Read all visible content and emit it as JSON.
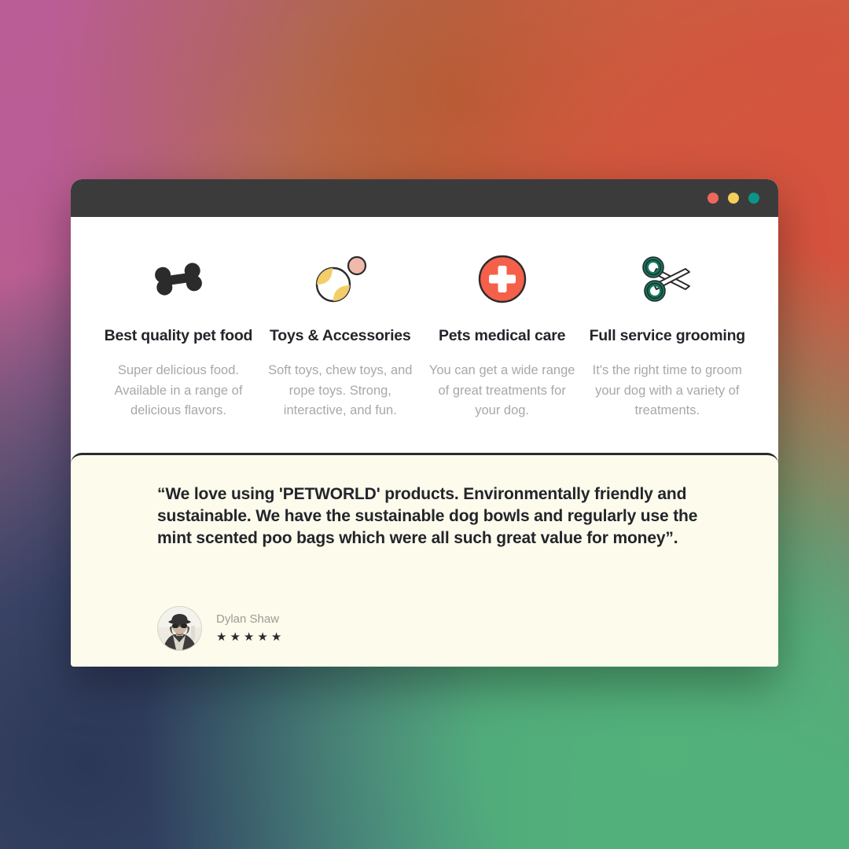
{
  "window": {
    "traffic_lights": [
      {
        "name": "close-button",
        "color": "#f0675c"
      },
      {
        "name": "minimize-button",
        "color": "#f5cd5a"
      },
      {
        "name": "maximize-button",
        "color": "#0d9488"
      }
    ]
  },
  "features": [
    {
      "icon": "bone-icon",
      "title": "Best quality pet food",
      "description": "Super delicious food. Available in a range of delicious flavors."
    },
    {
      "icon": "tennis-balls-icon",
      "title": "Toys & Accessories",
      "description": "Soft toys, chew toys, and rope toys. Strong, interactive, and fun."
    },
    {
      "icon": "medical-cross-icon",
      "title": "Pets medical care",
      "description": "You can get a wide range of great treatments for your dog."
    },
    {
      "icon": "scissors-icon",
      "title": "Full service grooming",
      "description": "It's the right time to groom your dog with a variety of treatments."
    }
  ],
  "testimonial": {
    "quote": "“We love using 'PETWORLD' products. Environmentally friendly and sustainable. We have the sustainable dog bowls and regularly use the mint scented poo bags which were all such great value for money”.",
    "author_name": "Dylan Shaw",
    "rating": 5,
    "star_glyph": "★"
  },
  "colors": {
    "panel_background": "#fdfbec",
    "card_background": "#ffffff",
    "titlebar": "#3b3b3b",
    "heading_text": "#22252a",
    "body_text": "#a8a8a8",
    "ball_yellow": "#f2ce6a",
    "ball_pink": "#f0b9ac",
    "cross_red": "#f5604b",
    "scissors_teal": "#0f7a5f"
  }
}
